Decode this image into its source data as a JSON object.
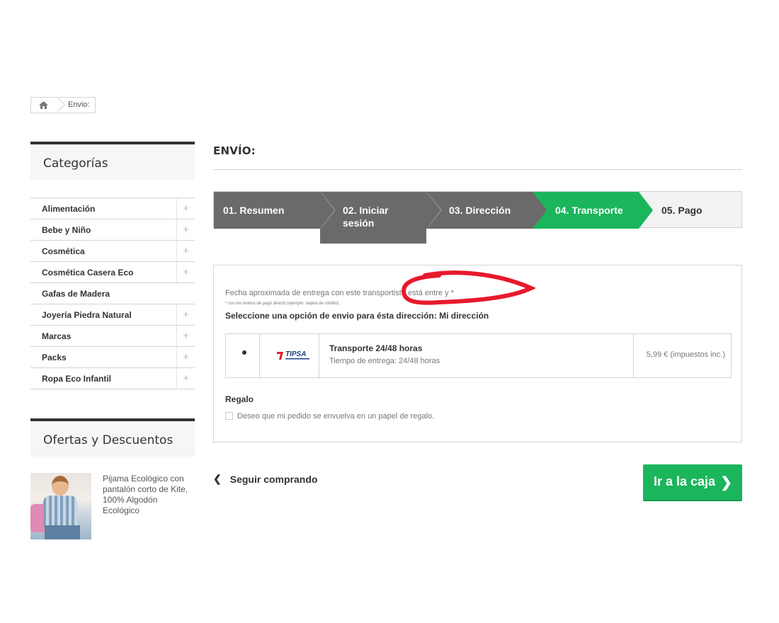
{
  "breadcrumb": {
    "current": "Envio:"
  },
  "sidebar": {
    "categories_title": "Categorías",
    "categories": [
      {
        "label": "Alimentación",
        "expandable": true
      },
      {
        "label": "Bebe y Niño",
        "expandable": true
      },
      {
        "label": "Cosmética",
        "expandable": true
      },
      {
        "label": "Cosmética Casera Eco",
        "expandable": true
      },
      {
        "label": "Gafas de Madera",
        "expandable": false
      },
      {
        "label": "Joyería Piedra Natural",
        "expandable": true
      },
      {
        "label": "Marcas",
        "expandable": true
      },
      {
        "label": "Packs",
        "expandable": true
      },
      {
        "label": "Ropa Eco Infantil",
        "expandable": true
      }
    ],
    "offers_title": "Ofertas y Descuentos",
    "offer": {
      "text": "Pijama Ecológico con pantalón corto de Kite, 100% Algodón Ecológico"
    }
  },
  "main": {
    "heading": "ENVÍO:",
    "steps": [
      {
        "label": "01. Resumen",
        "state": "done"
      },
      {
        "label": "02. Iniciar sesión",
        "state": "done"
      },
      {
        "label": "03. Dirección",
        "state": "done"
      },
      {
        "label": "04. Transporte",
        "state": "current"
      },
      {
        "label": "05. Pago",
        "state": "todo"
      }
    ],
    "delivery_date": "Fecha aproximada de entrega con este transportista está entre y *",
    "footnote": "* con los modos de pago directo (ejemplo: tarjeta de crédito)",
    "select_message": "Seleccione una opción de envio para ésta dirección: Mi dirección",
    "carrier": {
      "logo_text": "TIPSA",
      "name": "Transporte 24/48 horas",
      "delivery_time": "Tiempo de entrega: 24/48 horas",
      "price": "5,99 € (impuestos inc.)",
      "selected": true
    },
    "gift": {
      "title": "Regalo",
      "checkbox_label": "Deseo que mi pedido se envuelva en un papel de regalo.",
      "checked": false
    },
    "continue_label": "Seguir comprando",
    "checkout_label": "Ir a la caja"
  },
  "colors": {
    "accent_green": "#1bb55c",
    "step_dark": "#6a6a6a",
    "annotation_red": "#e8192c"
  }
}
